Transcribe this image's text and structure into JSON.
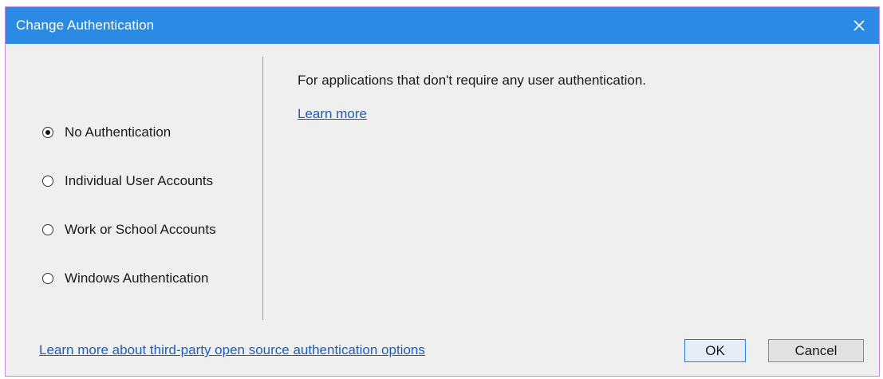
{
  "dialog": {
    "title": "Change Authentication",
    "close_icon": "close-icon"
  },
  "auth_options": {
    "selected": "No Authentication",
    "items": [
      {
        "label": "No Authentication",
        "checked": true
      },
      {
        "label": "Individual User Accounts",
        "checked": false
      },
      {
        "label": "Work or School Accounts",
        "checked": false
      },
      {
        "label": "Windows Authentication",
        "checked": false
      }
    ]
  },
  "details": {
    "description": "For applications that don't require any user authentication.",
    "learn_more": "Learn more"
  },
  "footer": {
    "third_party_link": "Learn more about third-party open source authentication options",
    "ok_label": "OK",
    "cancel_label": "Cancel"
  },
  "colors": {
    "titlebar": "#2b8ae3",
    "link": "#1d5fb8",
    "background": "#efefef"
  }
}
